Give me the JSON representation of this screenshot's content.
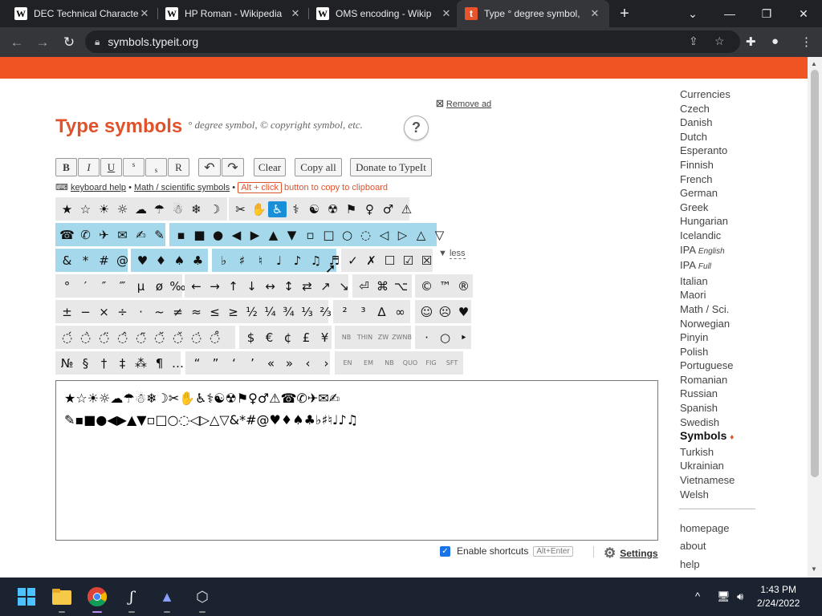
{
  "browser": {
    "tabs": [
      {
        "title": "DEC Technical Characte",
        "favicon": "W"
      },
      {
        "title": "HP Roman - Wikipedia",
        "favicon": "W"
      },
      {
        "title": "OMS encoding - Wikip",
        "favicon": "W"
      },
      {
        "title": "Type ° degree symbol,",
        "favicon": "t"
      }
    ],
    "new_tab": "+",
    "window_controls": [
      "⌄",
      "—",
      "❐",
      "✕"
    ],
    "url": "symbols.typeit.org",
    "nav_icons": [
      "back-icon",
      "forward-icon",
      "reload-icon"
    ]
  },
  "page": {
    "remove_ad": "Remove ad",
    "title": "Type symbols",
    "subtitle": "° degree symbol, © copyright symbol, etc.",
    "help": "?",
    "format_buttons": [
      "B",
      "I",
      "U",
      "s",
      "s",
      "R"
    ],
    "history_buttons": [
      "↶",
      "↷"
    ],
    "clear": "Clear",
    "copy_all": "Copy all",
    "donate": "Donate to TypeIt",
    "kb_help": "keyboard help",
    "bullet": " • ",
    "math_link": "Math / scientific symbols",
    "alt_click": "Alt + click",
    "clipboard_text": "button to copy to clipboard",
    "less": "less",
    "rows": [
      [
        [
          "★",
          "☆",
          "☀",
          "☼",
          "☁",
          "☂",
          "☃",
          "❄",
          "☽"
        ],
        [
          "✂",
          "✋",
          "♿",
          "⚕",
          "☯",
          "☢",
          "⚑",
          "♀",
          "♂",
          "⚠"
        ]
      ],
      [
        [
          "☎",
          "✆",
          "✈",
          "✉",
          "✍",
          "✎"
        ],
        [
          "▪",
          "■",
          "●",
          "◀",
          "▶",
          "▲",
          "▼",
          "▫",
          "□",
          "○",
          "◌",
          "◁",
          "▷",
          "△",
          "▽"
        ]
      ],
      [
        [
          "&",
          "*",
          "#",
          "@"
        ],
        [
          "♥",
          "♦",
          "♠",
          "♣"
        ],
        [
          "♭",
          "♯",
          "♮",
          "♩",
          "♪",
          "♫",
          "♬"
        ],
        [
          "✓",
          "✗",
          "☐",
          "☑",
          "☒"
        ]
      ],
      [
        [
          "°",
          "′",
          "″",
          "‴",
          "µ",
          "ø",
          "‰"
        ],
        [
          "←",
          "→",
          "↑",
          "↓",
          "↔",
          "↕",
          "⇄",
          "↗",
          "↘"
        ],
        [
          "⏎",
          "⌘",
          "⌥"
        ],
        [
          "©",
          "™",
          "®"
        ]
      ],
      [
        [
          "±",
          "−",
          "×",
          "÷",
          "·",
          "~",
          "≠",
          "≈",
          "≤",
          "≥",
          "½",
          "¼",
          "¾",
          "⅓",
          "⅔",
          "/"
        ],
        [
          "²",
          "³",
          "∆",
          "∞"
        ],
        [
          "☺",
          "☹",
          "♥"
        ]
      ],
      [
        [
          "◌́",
          "◌̀",
          "◌̈",
          "◌̂",
          "◌̃",
          "◌̆",
          "◌̌",
          "◌̇",
          "◌̊"
        ],
        [
          "$",
          "€",
          "¢",
          "£",
          "¥"
        ],
        [
          "NB",
          "THIN",
          "ZW",
          "ZWNB"
        ],
        [
          "·",
          "○",
          "‣"
        ]
      ],
      [
        [
          "№",
          "§",
          "†",
          "‡",
          "⁂",
          "¶",
          "…"
        ],
        [
          "“",
          "”",
          "‘",
          "’",
          "«",
          "»",
          "‹",
          "›"
        ],
        [
          "EN",
          "EM",
          "NB",
          "QUO",
          "FIG",
          "SFT"
        ]
      ]
    ],
    "textarea_value": "★☆☀☼☁☂☃❄☽✂✋♿⚕☯☢⚑♀♂⚠☎✆✈✉✍\n✎▪■●◀▶▲▼▫□○◌◁▷△▽&*#@♥♦♠♣♭♯♮♩♪♫",
    "enable_shortcuts": "Enable shortcuts",
    "shortcut_keys": "Alt+Enter",
    "settings": "Settings"
  },
  "sidebar": {
    "languages": [
      "Currencies",
      "Czech",
      "Danish",
      "Dutch",
      "Esperanto",
      "Finnish",
      "French",
      "German",
      "Greek",
      "Hungarian",
      "Icelandic"
    ],
    "ipa": [
      {
        "name": "IPA",
        "qual": "English"
      },
      {
        "name": "IPA",
        "qual": "Full"
      }
    ],
    "languages2": [
      "Italian",
      "Maori",
      "Math / Sci.",
      "Norwegian",
      "Pinyin",
      "Polish",
      "Portuguese",
      "Romanian",
      "Russian",
      "Spanish",
      "Swedish"
    ],
    "current": "Symbols",
    "current_mark": "♦",
    "languages3": [
      "Turkish",
      "Ukrainian",
      "Vietnamese",
      "Welsh"
    ],
    "links": [
      "homepage",
      "about",
      "help"
    ]
  },
  "taskbar": {
    "time": "1:43 PM",
    "date": "2/24/2022",
    "tray": "^"
  }
}
